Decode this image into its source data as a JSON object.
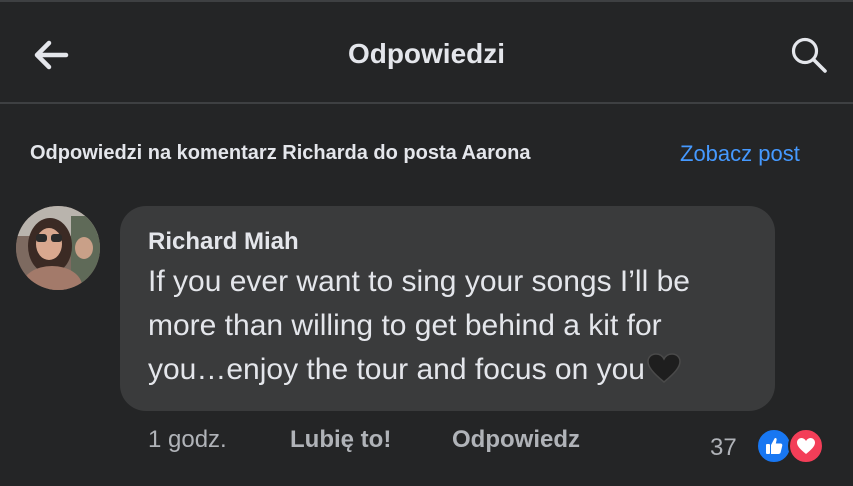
{
  "header": {
    "title": "Odpowiedzi",
    "back_icon": "arrow-left-icon",
    "search_icon": "search-icon"
  },
  "context": {
    "text": "Odpowiedzi na komentarz Richarda do posta Aarona",
    "link": "Zobacz post",
    "link_color": "#4599ff"
  },
  "comment": {
    "author": "Richard Miah",
    "text": "If you ever want to sing your songs I’ll be more than willing to get behind a kit for you…enjoy the tour and focus on you",
    "emoji": "black-heart-icon"
  },
  "actions": {
    "time": "1 godz.",
    "like": "Lubię to!",
    "reply": "Odpowiedz",
    "reaction_count": "37",
    "reactions": [
      "like-reaction-icon",
      "love-reaction-icon"
    ]
  },
  "colors": {
    "background": "#242526",
    "bubble": "#3a3b3c",
    "text": "#e4e6eb",
    "muted": "#b0b3b8",
    "like_blue": "#1877f2",
    "love_red": "#f33e58"
  }
}
